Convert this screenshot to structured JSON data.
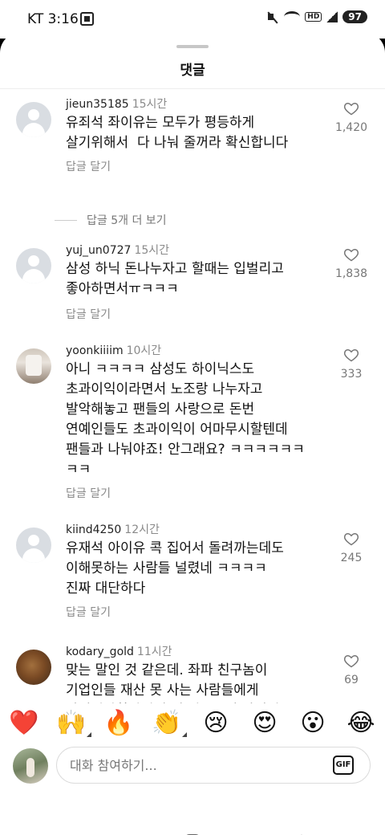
{
  "status_bar": {
    "time": "KT 3:16",
    "hd_label": "HD",
    "battery": "97"
  },
  "sheet": {
    "title": "댓글"
  },
  "comments": [
    {
      "username": "jieun35185",
      "time_ago": "15시간",
      "text": "유죄석 좌이유는 모두가 평등하게\n살기위해서  다 나눠 줄꺼라 확신합니다",
      "reply_label": "답글 달기",
      "likes": "1,420",
      "avatar": "default-avatar"
    },
    {
      "username": "yuj_un0727",
      "time_ago": "15시간",
      "text": "삼성 하닉 돈나누자고 할때는 입벌리고\n좋아하면서ㅠㅋㅋㅋ",
      "reply_label": "답글 달기",
      "likes": "1,838",
      "avatar": "default-avatar"
    },
    {
      "username": "yoonkiiiim",
      "time_ago": "10시간",
      "text": "아니 ㅋㅋㅋㅋ 삼성도 하이닉스도\n초과이익이라면서 노조랑 나누자고\n발악해놓고 팬들의 사랑으로 돈번\n연예인들도 초과이익이 어마무시할텐데\n팬들과 나눠야죠! 안그래요? ㅋㅋㅋㅋㅋㅋ\nㅋㅋ",
      "reply_label": "답글 달기",
      "likes": "333",
      "avatar": "photo-avatar"
    },
    {
      "username": "kiind4250",
      "time_ago": "12시간",
      "text": "유재석 아이유 콕 집어서 돌려까는데도\n이해못하는 사람들 널렸네 ㅋㅋㅋㅋ\n진짜 대단하다",
      "reply_label": "답글 달기",
      "likes": "245",
      "avatar": "default-avatar"
    },
    {
      "username": "kodary_gold",
      "time_ago": "11시간",
      "text": "맞는 말인 것 같은데. 좌파 친구놈이\n기업인들 재산 못 사는 사람들에게\n나눠줘야한다길래 네 월급부터 나눠줘~\n카니까 자기 많이 못 벌어서 못 준다고",
      "reply_label": "",
      "likes": "69",
      "avatar": "photo-avatar"
    }
  ],
  "more_replies": {
    "label": "답글 5개 더 보기"
  },
  "emoji_bar": [
    {
      "icon": "red-heart-emoji",
      "glyph": "❤️"
    },
    {
      "icon": "raising-hands-emoji",
      "glyph": "🙌"
    },
    {
      "icon": "fire-emoji",
      "glyph": "🔥"
    },
    {
      "icon": "clapping-hands-emoji",
      "glyph": "👏"
    },
    {
      "icon": "crying-face-emoji",
      "glyph": "😢"
    },
    {
      "icon": "heart-eyes-emoji",
      "glyph": "😍"
    },
    {
      "icon": "surprised-face-emoji",
      "glyph": "😮"
    },
    {
      "icon": "tears-of-joy-emoji",
      "glyph": "😂"
    }
  ],
  "composer": {
    "placeholder": "대화 참여하기...",
    "gif_label": "GIF"
  },
  "nav_bar": {
    "icons": [
      "recents-icon",
      "home-icon",
      "back-icon"
    ]
  },
  "colors": {
    "text_primary": "#111111",
    "text_secondary": "#8a8a8a",
    "heart_emoji": "#e0344a"
  }
}
